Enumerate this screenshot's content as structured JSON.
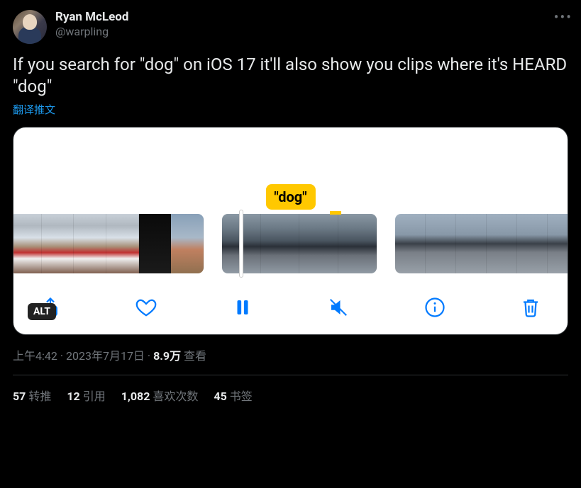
{
  "user": {
    "display_name": "Ryan McLeod",
    "handle": "@warpling"
  },
  "tweet_text": "If you search for \"dog\" on iOS 17 it'll also show you clips where it's HEARD \"dog\"",
  "translate_label": "翻译推文",
  "media": {
    "caption_text": "\"dog\"",
    "alt_badge": "ALT"
  },
  "meta": {
    "time": "上午4:42",
    "sep": " · ",
    "date": "2023年7月17日",
    "views_count": "8.9万",
    "views_label": " 查看"
  },
  "stats": {
    "retweets_num": "57",
    "retweets_label": "转推",
    "quotes_num": "12",
    "quotes_label": "引用",
    "likes_num": "1,082",
    "likes_label": "喜欢次数",
    "bookmarks_num": "45",
    "bookmarks_label": "书签"
  }
}
